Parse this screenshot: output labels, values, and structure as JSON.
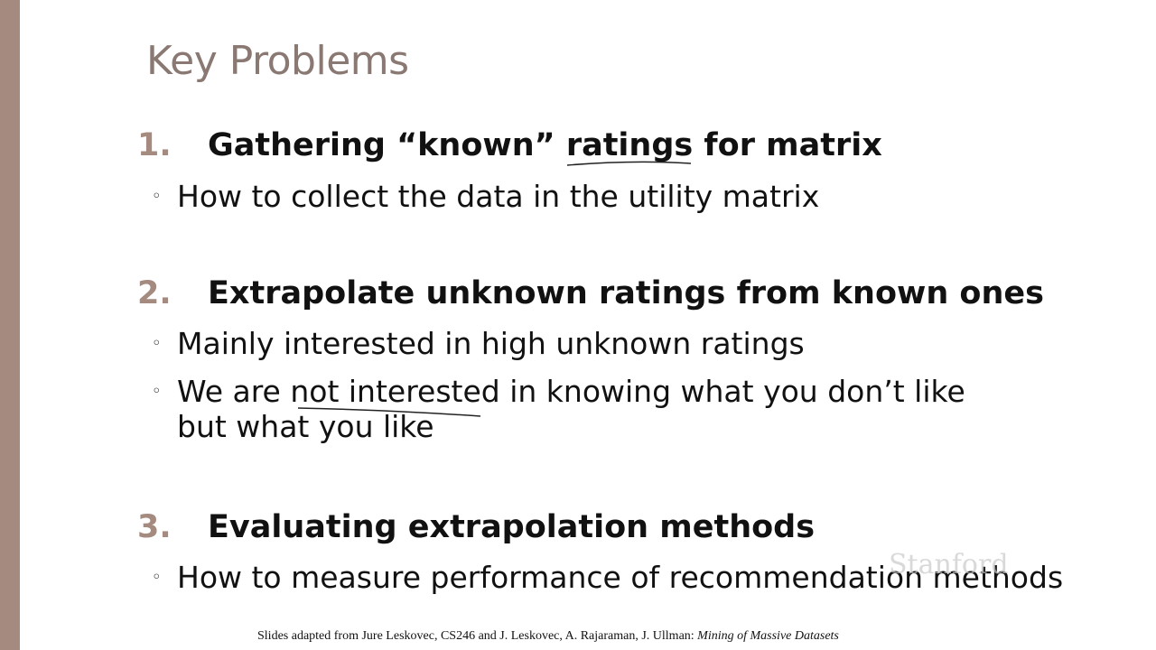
{
  "slide": {
    "title": "Key Problems",
    "items": [
      {
        "number": "1.",
        "heading": "Gathering “known” ratings for matrix",
        "bullets": [
          "How to collect the data in the utility matrix"
        ]
      },
      {
        "number": "2.",
        "heading": "Extrapolate unknown ratings from known ones",
        "bullets": [
          "Mainly interested in high unknown ratings",
          "We are not interested in knowing what you don’t like",
          "but what you like"
        ]
      },
      {
        "number": "3.",
        "heading": "Evaluating extrapolation methods",
        "bullets": [
          "How to measure performance of recommendation methods"
        ]
      }
    ],
    "watermark": "Stanford",
    "footer": {
      "prefix": "Slides adapted from  Jure Leskovec, CS246 and J. Leskovec, A. Rajaraman, J. Ullman: ",
      "book": "Mining of Massive Datasets"
    }
  },
  "colors": {
    "accent": "#a58a80",
    "title": "#8a7872",
    "text": "#111111"
  }
}
